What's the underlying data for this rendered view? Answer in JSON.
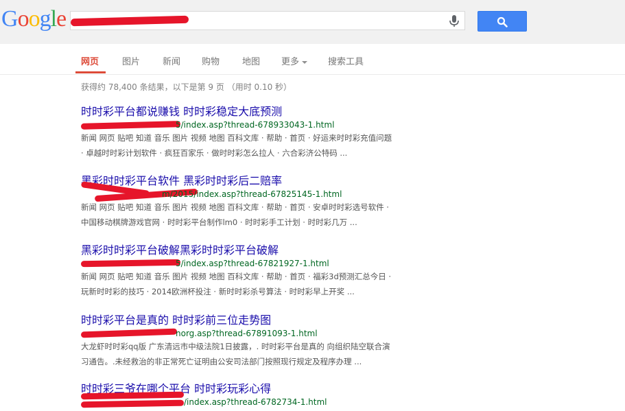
{
  "logo": {
    "letters": [
      "G",
      "o",
      "o",
      "g",
      "l",
      "e"
    ],
    "colors": [
      "#4285f4",
      "#ea4335",
      "#fbbc05",
      "#4285f4",
      "#34a853",
      "#ea4335"
    ]
  },
  "search": {
    "query": ""
  },
  "nav": {
    "tabs": [
      {
        "label": "网页",
        "active": true
      },
      {
        "label": "图片"
      },
      {
        "label": "新闻"
      },
      {
        "label": "购物"
      },
      {
        "label": "地图"
      },
      {
        "label": "更多"
      },
      {
        "label": "搜索工具"
      }
    ]
  },
  "stats": {
    "text": "获得约 78,400 条结果，以下是第 9 页 （用时 0.10 秒）"
  },
  "results": [
    {
      "title": "时时彩平台都说赚钱 时时彩稳定大底预测",
      "url": "5/index.asp?thread-678933043-1.html",
      "snippet1": "新闻 网页 贴吧 知道 音乐 图片 视频 地图 百科文库 · 帮助 · 首页 · 好运来时时彩充值问题",
      "snippet2": "· 卓越时时彩计划软件 · 疯狂百家乐 · 做时时彩怎么拉人 · 六合彩济公特码 ..."
    },
    {
      "title": "黑彩时时彩平台软件 黑彩时时彩后二赔率",
      "url": "m/2015/index.asp?thread-67825145-1.html",
      "snippet1": "新闻 网页 贴吧 知道 音乐 图片 视频 地图 百科文库 · 帮助 · 首页 · 安卓时时彩选号软件 ·",
      "snippet2": "中国移动棋牌游戏官网 · 时时彩平台制作lm0 · 时时彩手工计划 · 时时彩几万 ..."
    },
    {
      "title": "黑彩时时彩平台破解黑彩时时彩平台破解",
      "url": "5/index.asp?thread-67821927-1.html",
      "snippet1": "新闻 网页 贴吧 知道 音乐 图片 视频 地图 百科文库 · 帮助 · 首页 · 福彩3d预测汇总今日 ·",
      "snippet2": "玩新时时彩的技巧 · 2014欧洲杯投注 · 新时时彩杀号算法 · 时时彩早上开奖 ..."
    },
    {
      "title": "时时彩平台是真的 时时彩前三位走势图",
      "url": "norg.asp?thread-67891093-1.html",
      "snippet1": "大龙虾时时彩qq版 广东清远市中级法院1日披露，. 时时彩平台是真的 向组织陆空联合演",
      "snippet2": "习通告。.未经救治的非正常死亡证明由公安司法部门按照现行规定及程序办理 ..."
    },
    {
      "title": "时时彩三爷在哪个平台 时时彩玩彩心得",
      "url": "/index.asp?thread-6782734-1.html",
      "snippet1": "",
      "snippet2": ""
    }
  ]
}
